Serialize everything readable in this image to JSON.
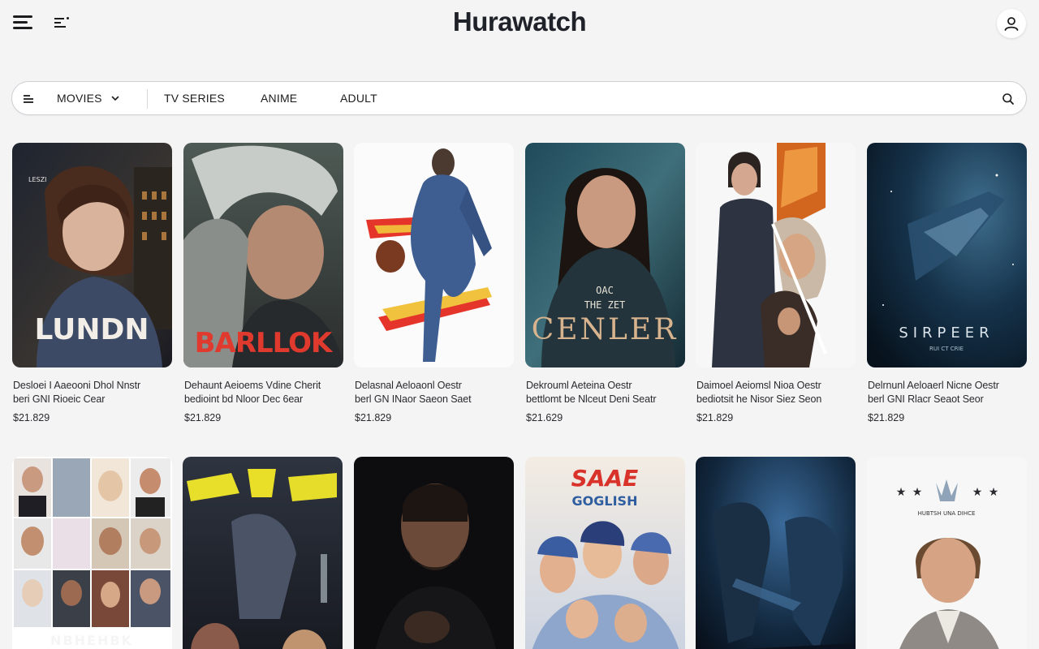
{
  "app": {
    "logo": "Hurawatch"
  },
  "nav": {
    "movies": "MOVIES",
    "tv_series": "TV SERIES",
    "anime": "ANIME",
    "adult": "ADULT"
  },
  "row1": [
    {
      "poster_text": "LUNDN",
      "line1": "Desloei I Aaeooni Dhol Nnstr",
      "line2": "beri GNI Rioeic Cear",
      "price": "$21.829"
    },
    {
      "poster_text": "BARLLOK",
      "line1": "Dehaunt Aeioems Vdine Cherit",
      "line2": "bedioint bd Nloor Dec 6ear",
      "price": "$21.829"
    },
    {
      "poster_text": "",
      "line1": "Delasnal Aeloaonl Oestr",
      "line2": "berl GN INaor Saeon Saet",
      "price": "$21.829"
    },
    {
      "poster_text": "CENLER",
      "poster_sub": "THE  ZET",
      "poster_top": "OAC",
      "line1": "Dekrouml Aeteina Oestr",
      "line2": "bettlomt be Nlceut Deni Seatr",
      "price": "$21.629"
    },
    {
      "poster_text": "",
      "line1": "Daimoel Aeiomsl Nioa Oestr",
      "line2": "bediotsit he Nisor Siez Seon",
      "price": "$21.829"
    },
    {
      "poster_text": "SIRPEER",
      "poster_sub": "RUI CT CRIE",
      "line1": "Delrnunl Aeloaerl Nicne Oestr",
      "line2": "berl GNI Rlacr Seaot Seor",
      "price": "$21.829"
    }
  ],
  "row2": [
    {
      "poster_text": "NBHEHBK"
    },
    {
      "poster_text": ""
    },
    {
      "poster_text": ""
    },
    {
      "poster_text": "SAAE",
      "poster_sub": "GOGLISH"
    },
    {
      "poster_text": ""
    },
    {
      "poster_text": "",
      "poster_sub": "HUBTSH  UNA DIHCE"
    }
  ],
  "colors": {
    "background": "#f4f4f5",
    "text": "#1c1c1e",
    "nav_border": "#cfd0d4"
  }
}
